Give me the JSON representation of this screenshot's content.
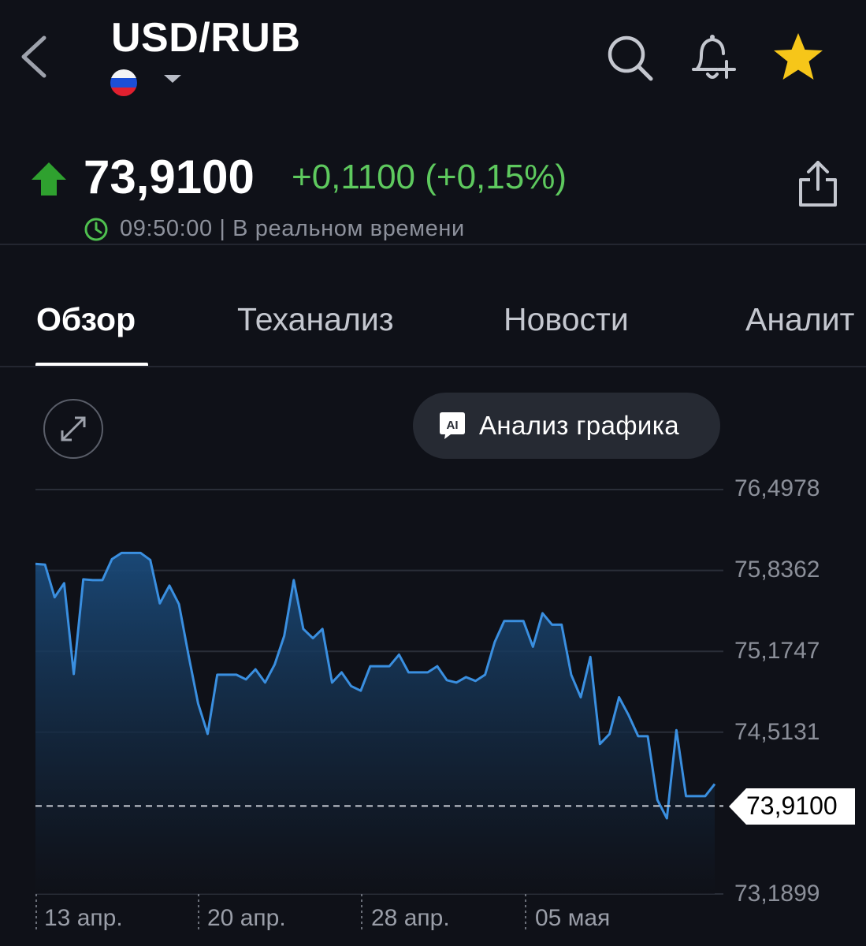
{
  "header": {
    "title": "USD/RUB",
    "back_icon": "chevron-left-icon",
    "flag": "russia-flag",
    "actions": [
      "search-icon",
      "bell-plus-icon",
      "star-icon"
    ],
    "star_color": "#f6c619"
  },
  "quote": {
    "price": "73,9100",
    "change": "+0,1100 (+0,15%)",
    "direction": "up",
    "up_color": "#2fa12f",
    "change_color": "#5ec95e",
    "time": "09:50:00 | В реальном времени"
  },
  "tabs": [
    {
      "label": "Обзор",
      "active": true
    },
    {
      "label": "Теханализ",
      "active": false
    },
    {
      "label": "Новости",
      "active": false
    },
    {
      "label": "Аналит",
      "active": false
    }
  ],
  "chart_controls": {
    "ai_button_label": "Анализ графика",
    "ai_icon_text": "AI"
  },
  "chart_data": {
    "type": "area",
    "line_color": "#3a8fe0",
    "y_ticks": [
      "76,4978",
      "75,8362",
      "75,1747",
      "74,5131",
      "73,1899"
    ],
    "ylim": [
      73.1899,
      76.4978
    ],
    "x_ticks": [
      "13 апр.",
      "20 апр.",
      "28 апр.",
      "05 мая"
    ],
    "current_value": "73,9100",
    "values": [
      75.8904,
      75.8839,
      75.6173,
      75.7317,
      74.9891,
      75.7635,
      75.7572,
      75.7572,
      75.9284,
      75.9793,
      75.9793,
      75.9793,
      75.9221,
      75.5665,
      75.7127,
      75.5601,
      75.1411,
      74.7477,
      74.4997,
      74.983,
      74.983,
      74.983,
      74.9451,
      75.0274,
      74.9195,
      75.0655,
      75.3008,
      75.757,
      75.358,
      75.2819,
      75.358,
      74.9195,
      75.0023,
      74.8902,
      74.8525,
      75.0529,
      75.0529,
      75.0529,
      75.1478,
      75.0023,
      75.0023,
      75.0023,
      75.0529,
      74.9387,
      74.9195,
      74.9641,
      74.9321,
      74.9829,
      75.2503,
      75.4227,
      75.4227,
      75.4227,
      75.2119,
      75.4863,
      75.3927,
      75.3927,
      74.9832,
      74.799,
      75.129,
      74.4166,
      74.498,
      74.799,
      74.653,
      74.48,
      74.48,
      73.96,
      73.808,
      74.53,
      73.99,
      73.99,
      73.99,
      74.089
    ]
  }
}
